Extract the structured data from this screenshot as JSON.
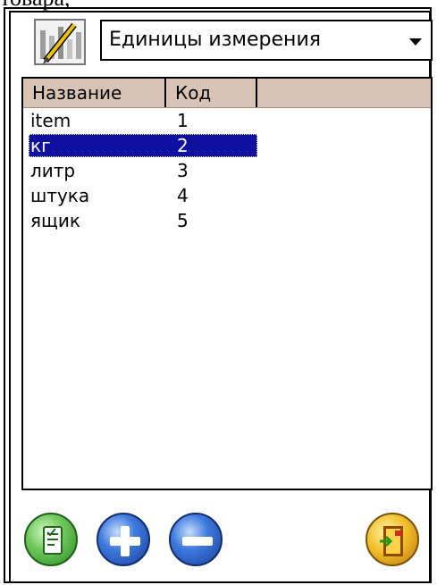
{
  "caption": "товара,",
  "combo": {
    "selected": "Единицы измерения"
  },
  "list": {
    "columns": [
      "Название",
      "Код"
    ],
    "rows": [
      {
        "name": "item",
        "code": "1",
        "selected": false
      },
      {
        "name": "кг",
        "code": "2",
        "selected": true
      },
      {
        "name": "литр",
        "code": "3",
        "selected": false
      },
      {
        "name": "штука",
        "code": "4",
        "selected": false
      },
      {
        "name": "ящик",
        "code": "5",
        "selected": false
      }
    ]
  },
  "icons": {
    "app": "edit-window-icon",
    "edit": "edit-document-icon",
    "add": "plus-icon",
    "delete": "minus-icon",
    "exit": "exit-door-icon"
  }
}
